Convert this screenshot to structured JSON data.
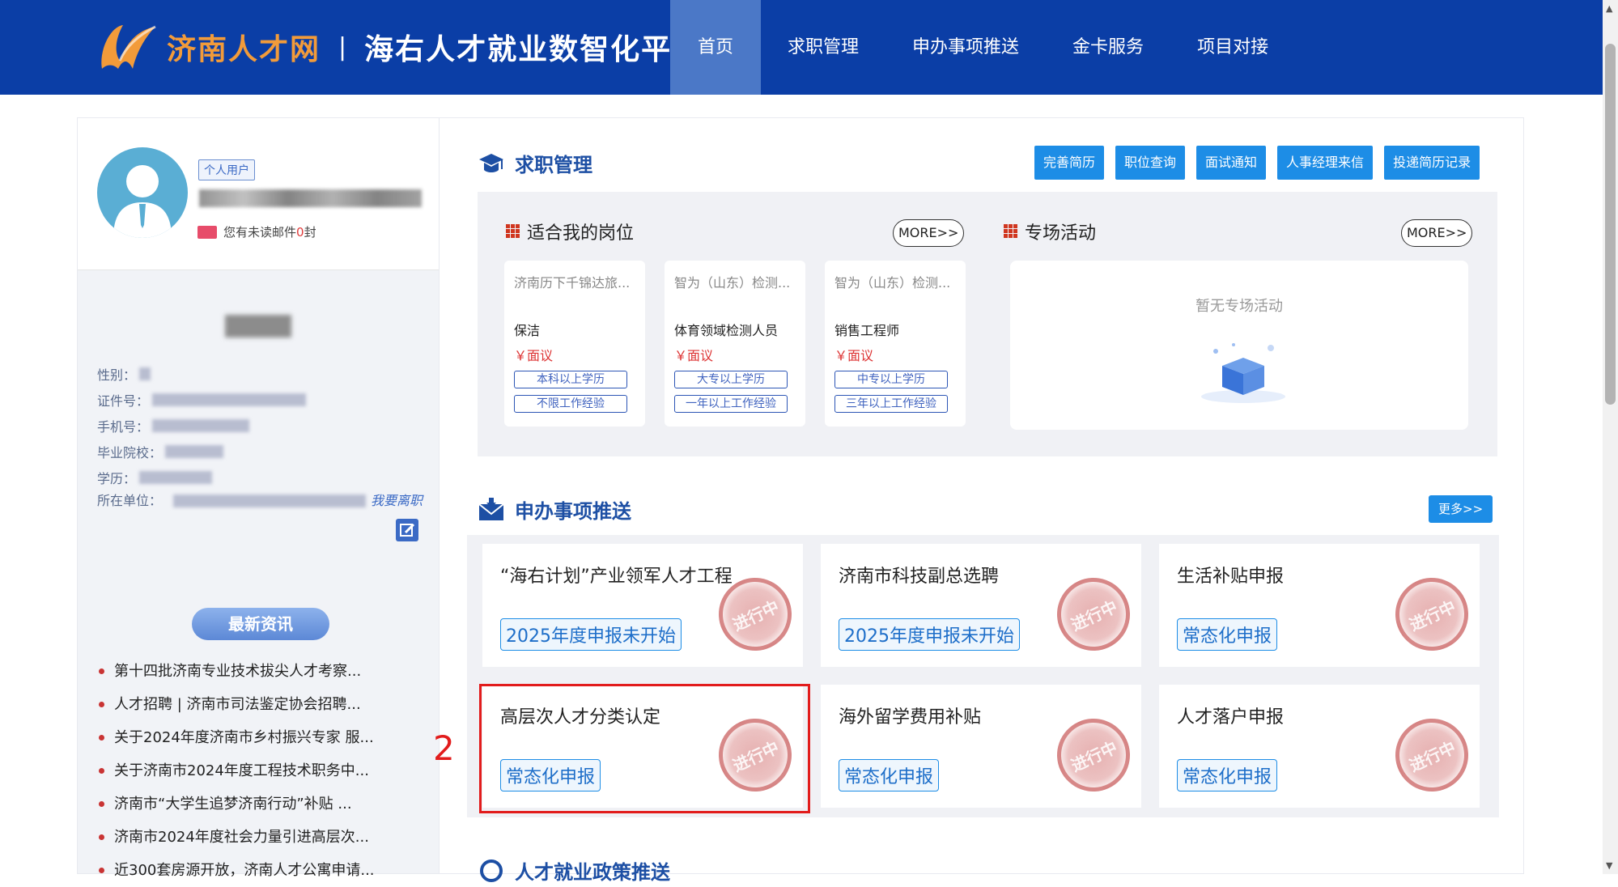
{
  "header": {
    "logo_text": "济南人才网",
    "separator": "|",
    "platform_name": "海右人才就业数智化平台",
    "nav": [
      {
        "label": "首页",
        "active": true
      },
      {
        "label": "求职管理",
        "active": false
      },
      {
        "label": "申办事项推送",
        "active": false
      },
      {
        "label": "金卡服务",
        "active": false
      },
      {
        "label": "项目对接",
        "active": false
      }
    ]
  },
  "profile": {
    "user_tag": "个人用户",
    "mail_prefix": "您有未读邮件",
    "mail_count": "0",
    "mail_suffix": "封",
    "fields": [
      {
        "label": "性别："
      },
      {
        "label": "证件号："
      },
      {
        "label": "手机号："
      },
      {
        "label": "毕业院校："
      },
      {
        "label": "学历："
      },
      {
        "label": "所在单位："
      }
    ],
    "quit_link": "我要离职"
  },
  "news": {
    "header": "最新资讯",
    "items": [
      "第十四批济南专业技术拔尖人才考察...",
      "人才招聘 | 济南市司法鉴定协会招聘...",
      "关于2024年度济南市乡村振兴专家 服...",
      "关于济南市2024年度工程技术职务中...",
      "济南市“大学生追梦济南行动”补贴 ...",
      "济南市2024年度社会力量引进高层次...",
      "近300套房源开放，济南人才公寓申请..."
    ]
  },
  "job_section": {
    "title": "求职管理",
    "buttons": [
      "完善简历",
      "职位查询",
      "面试通知",
      "人事经理来信",
      "投递简历记录"
    ],
    "suitable_title": "适合我的岗位",
    "more_label": "MORE>>",
    "jobs": [
      {
        "company": "济南历下千锦达旅...",
        "title": "保洁",
        "salary": "￥面议",
        "tags": [
          "本科以上学历",
          "不限工作经验"
        ]
      },
      {
        "company": "智为（山东）检测...",
        "title": "体育领域检测人员",
        "salary": "￥面议",
        "tags": [
          "大专以上学历",
          "一年以上工作经验"
        ]
      },
      {
        "company": "智为（山东）检测...",
        "title": "销售工程师",
        "salary": "￥面议",
        "tags": [
          "中专以上学历",
          "三年以上工作经验"
        ]
      }
    ],
    "activity_title": "专场活动",
    "no_activity": "暂无专场活动"
  },
  "affairs_section": {
    "title": "申办事项推送",
    "more_label": "更多>>",
    "stamp_text": "进行中",
    "items": [
      {
        "title": "“海右计划”产业领军人才工程",
        "tag": "2025年度申报未开始"
      },
      {
        "title": "济南市科技副总选聘",
        "tag": "2025年度申报未开始"
      },
      {
        "title": "生活补贴申报",
        "tag": "常态化申报"
      },
      {
        "title": "高层次人才分类认定",
        "tag": "常态化申报"
      },
      {
        "title": "海外留学费用补贴",
        "tag": "常态化申报"
      },
      {
        "title": "人才落户申报",
        "tag": "常态化申报"
      }
    ]
  },
  "annotation": {
    "marker": "2"
  },
  "policy_section": {
    "title": "人才就业政策推送"
  },
  "colors": {
    "header_bg": "#0b3ea6",
    "nav_active": "#4b78c7",
    "accent_blue": "#1d8de6",
    "highlight_red": "#e21c1c"
  }
}
